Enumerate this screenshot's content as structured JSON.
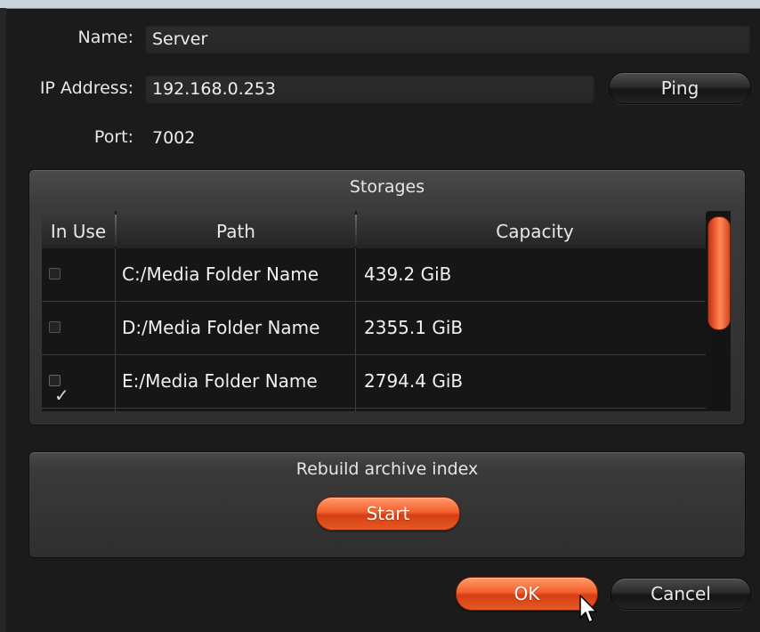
{
  "form": {
    "name_label": "Name:",
    "name_value": "Server",
    "ip_label": "IP Address:",
    "ip_value": "192.168.0.253",
    "ping_label": "Ping",
    "port_label": "Port:",
    "port_value": "7002"
  },
  "storages": {
    "title": "Storages",
    "columns": [
      "In Use",
      "Path",
      "Capacity"
    ],
    "rows": [
      {
        "in_use": false,
        "path": "C:/Media Folder Name",
        "capacity": "439.2 GiB"
      },
      {
        "in_use": false,
        "path": "D:/Media Folder Name",
        "capacity": "2355.1 GiB"
      },
      {
        "in_use": true,
        "path": "E:/Media Folder Name",
        "capacity": "2794.4 GiB"
      }
    ]
  },
  "rebuild": {
    "title": "Rebuild archive index",
    "start_label": "Start"
  },
  "footer": {
    "ok_label": "OK",
    "cancel_label": "Cancel"
  },
  "icons": {
    "checkmark": "checkmark-icon",
    "cursor": "mouse-pointer-icon"
  },
  "colors": {
    "accent": "#f4602e",
    "background": "#1b1b1b"
  }
}
